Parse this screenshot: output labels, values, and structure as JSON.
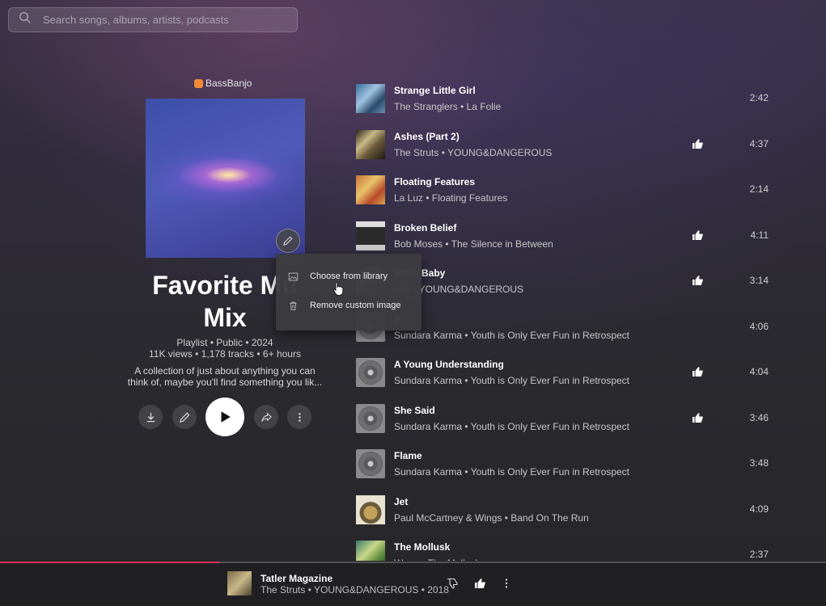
{
  "search": {
    "placeholder": "Search songs, albums, artists, podcasts"
  },
  "playlist": {
    "owner": "BassBanjo",
    "title_line1": "Favorite Mu",
    "title_line2": "Mix",
    "meta_line1": "Playlist • Public • 2024",
    "meta_line2": "11K views • 1,178 tracks • 6+ hours",
    "description_line1": "A collection of just about anything you can",
    "description_line2": "think of, maybe you'll find something you lik..."
  },
  "menu": {
    "items": [
      {
        "label": "Choose from library",
        "icon": "image-icon"
      },
      {
        "label": "Remove custom image",
        "icon": "trash-icon"
      }
    ]
  },
  "tracks": [
    {
      "title": "Strange Little Girl",
      "subtitle": "The Stranglers • La Folie",
      "duration": "2:42",
      "liked": false
    },
    {
      "title": "Ashes (Part 2)",
      "subtitle": "The Struts • YOUNG&DANGEROUS",
      "duration": "4:37",
      "liked": true
    },
    {
      "title": "Floating Features",
      "subtitle": "La Luz • Floating Features",
      "duration": "2:14",
      "liked": false
    },
    {
      "title": "Broken Belief",
      "subtitle": "Bob Moses • The Silence in Between",
      "duration": "4:11",
      "liked": true
    },
    {
      "title": "proof Baby",
      "subtitle": "ruts • YOUNG&DANGEROUS",
      "duration": "3:14",
      "liked": true
    },
    {
      "title": "e",
      "subtitle": "Sundara Karma • Youth is Only Ever Fun in Retrospect",
      "duration": "4:06",
      "liked": false
    },
    {
      "title": "A Young Understanding",
      "subtitle": "Sundara Karma • Youth is Only Ever Fun in Retrospect",
      "duration": "4:04",
      "liked": true
    },
    {
      "title": "She Said",
      "subtitle": "Sundara Karma • Youth is Only Ever Fun in Retrospect",
      "duration": "3:46",
      "liked": true
    },
    {
      "title": "Flame",
      "subtitle": "Sundara Karma • Youth is Only Ever Fun in Retrospect",
      "duration": "3:48",
      "liked": false
    },
    {
      "title": "Jet",
      "subtitle": "Paul McCartney & Wings • Band On The Run",
      "duration": "4:09",
      "liked": false
    },
    {
      "title": "The Mollusk",
      "subtitle": "Ween • The Mollusk",
      "duration": "2:37",
      "liked": false
    }
  ],
  "now_playing": {
    "title": "Tatler Magazine",
    "subtitle": "The Struts • YOUNG&DANGEROUS • 2018",
    "progress": 0.265
  },
  "colors": {
    "accent": "#e0325a",
    "owner_avatar": "#f08a3a"
  }
}
